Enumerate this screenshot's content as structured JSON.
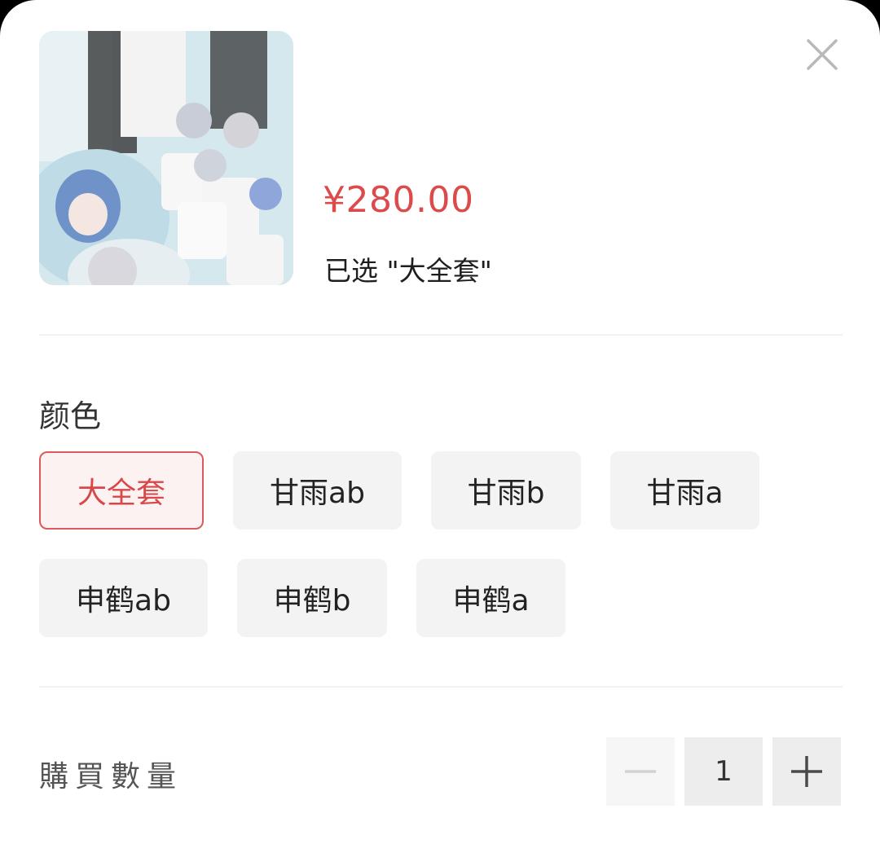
{
  "product": {
    "image_label": "product-photo",
    "price": "¥280.00",
    "selected_text": "已选 \"大全套\""
  },
  "options": {
    "label": "颜色",
    "items": [
      {
        "label": "大全套",
        "selected": true
      },
      {
        "label": "甘雨ab",
        "selected": false
      },
      {
        "label": "甘雨b",
        "selected": false
      },
      {
        "label": "甘雨a",
        "selected": false
      },
      {
        "label": "申鹤ab",
        "selected": false
      },
      {
        "label": "申鹤b",
        "selected": false
      },
      {
        "label": "申鹤a",
        "selected": false
      }
    ]
  },
  "quantity": {
    "label": "購買數量",
    "value": "1",
    "minus_icon": "minus-icon",
    "plus_icon": "plus-icon"
  },
  "icons": {
    "close": "close-icon"
  },
  "colors": {
    "accent": "#dc4a4a",
    "chip_bg": "#f3f3f3",
    "selected_bg": "#fdf2f2"
  }
}
